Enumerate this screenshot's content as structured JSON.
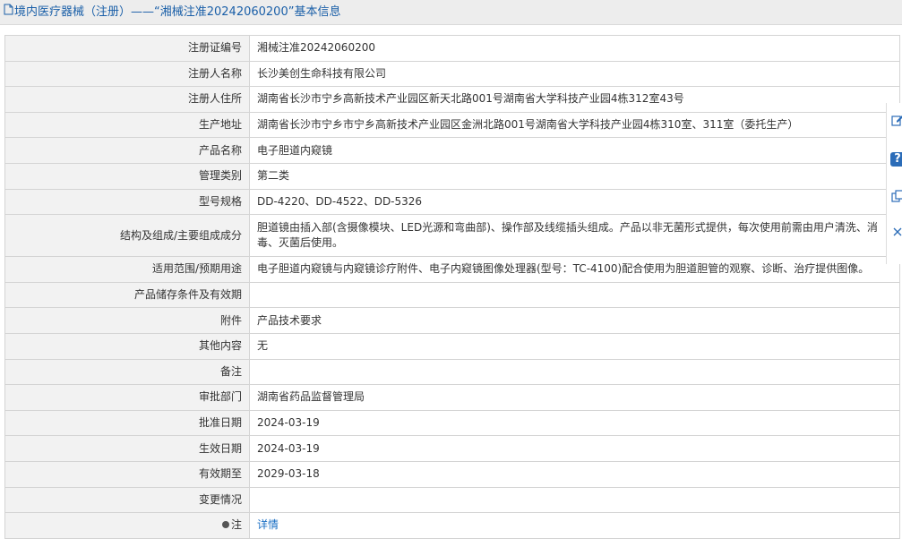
{
  "header": {
    "icon": "document-icon",
    "title": "境内医疗器械（注册）——“湘械注准20242060200”基本信息"
  },
  "rows": [
    {
      "label": "注册证编号",
      "value": "湘械注准20242060200"
    },
    {
      "label": "注册人名称",
      "value": "长沙美创生命科技有限公司"
    },
    {
      "label": "注册人住所",
      "value": "湖南省长沙市宁乡高新技术产业园区新天北路001号湖南省大学科技产业园4栋312室43号"
    },
    {
      "label": "生产地址",
      "value": "湖南省长沙市宁乡市宁乡高新技术产业园区金洲北路001号湖南省大学科技产业园4栋310室、311室（委托生产）"
    },
    {
      "label": "产品名称",
      "value": "电子胆道内窥镜"
    },
    {
      "label": "管理类别",
      "value": "第二类"
    },
    {
      "label": "型号规格",
      "value": "DD-4220、DD-4522、DD-5326"
    },
    {
      "label": "结构及组成/主要组成成分",
      "value": "胆道镜由插入部(含摄像模块、LED光源和弯曲部)、操作部及线缆插头组成。产品以非无菌形式提供，每次使用前需由用户清洗、消毒、灭菌后使用。"
    },
    {
      "label": "适用范围/预期用途",
      "value": "电子胆道内窥镜与内窥镜诊疗附件、电子内窥镜图像处理器(型号：TC-4100)配合使用为胆道胆管的观察、诊断、治疗提供图像。"
    },
    {
      "label": "产品储存条件及有效期",
      "value": ""
    },
    {
      "label": "附件",
      "value": "产品技术要求"
    },
    {
      "label": "其他内容",
      "value": "无"
    },
    {
      "label": "备注",
      "value": ""
    },
    {
      "label": "审批部门",
      "value": "湖南省药品监督管理局"
    },
    {
      "label": "批准日期",
      "value": "2024-03-19"
    },
    {
      "label": "生效日期",
      "value": "2024-03-19"
    },
    {
      "label": "有效期至",
      "value": "2029-03-18"
    },
    {
      "label": "变更情况",
      "value": ""
    }
  ],
  "note_row": {
    "label": "注",
    "icon": "lightbulb-icon",
    "link": "详情"
  },
  "sidebar": {
    "icons": [
      "edit-icon",
      "help-icon",
      "copy-icon",
      "close-icon"
    ]
  },
  "colors": {
    "title": "#1a5fa8",
    "link": "#1a6fc4",
    "label_bg": "#f2f2f2",
    "border": "#d4d4d4"
  }
}
